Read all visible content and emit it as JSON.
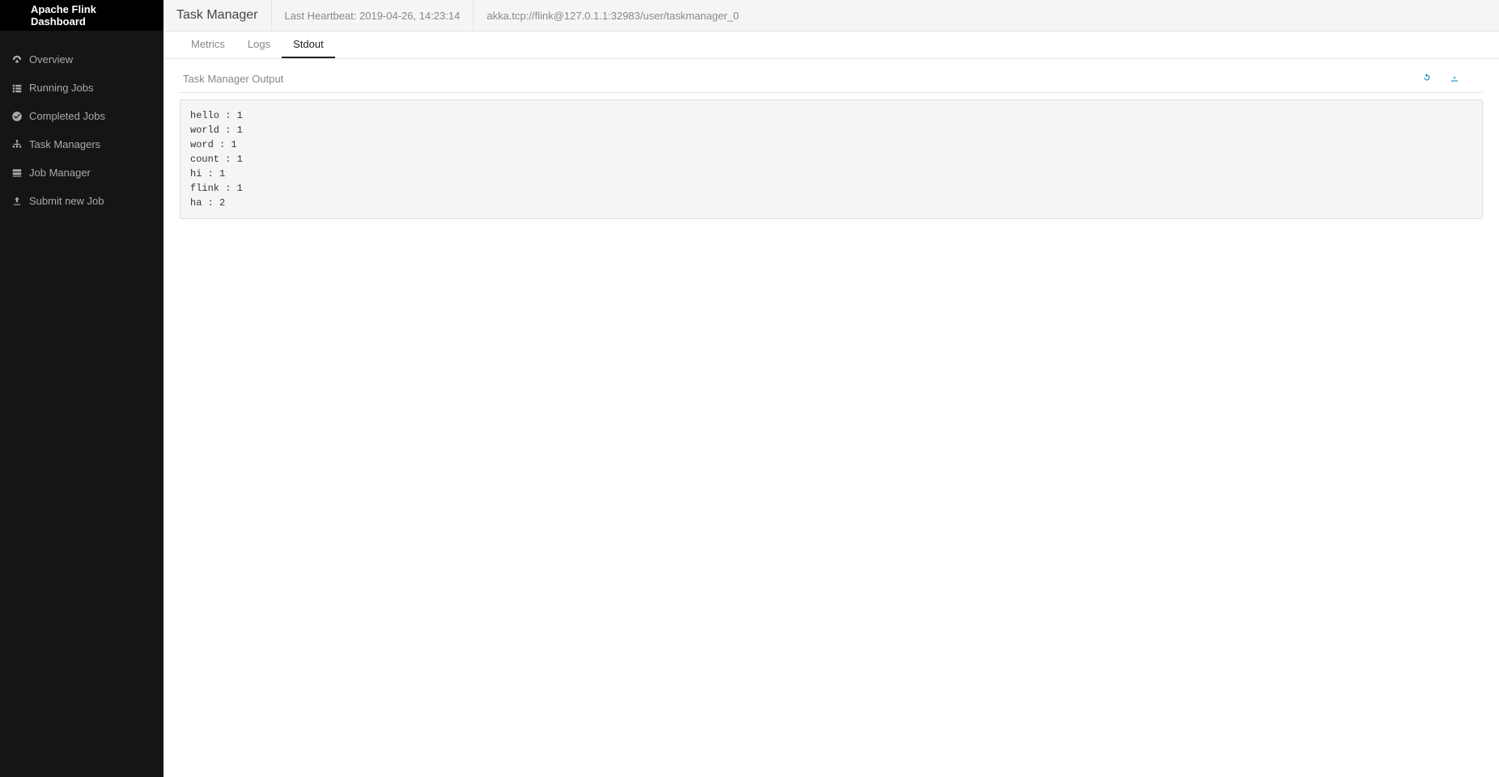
{
  "brand": {
    "title": "Apache Flink Dashboard"
  },
  "sidebar": {
    "items": [
      {
        "label": "Overview"
      },
      {
        "label": "Running Jobs"
      },
      {
        "label": "Completed Jobs"
      },
      {
        "label": "Task Managers"
      },
      {
        "label": "Job Manager"
      },
      {
        "label": "Submit new Job"
      }
    ]
  },
  "header": {
    "title": "Task Manager",
    "heartbeat_label": "Last Heartbeat:",
    "heartbeat_value": "2019-04-26, 14:23:14",
    "path": "akka.tcp://flink@127.0.1.1:32983/user/taskmanager_0"
  },
  "tabs": [
    {
      "label": "Metrics",
      "active": false
    },
    {
      "label": "Logs",
      "active": false
    },
    {
      "label": "Stdout",
      "active": true
    }
  ],
  "section": {
    "title": "Task Manager Output"
  },
  "output": "hello : 1\nworld : 1\nword : 1\ncount : 1\nhi : 1\nflink : 1\nha : 2"
}
